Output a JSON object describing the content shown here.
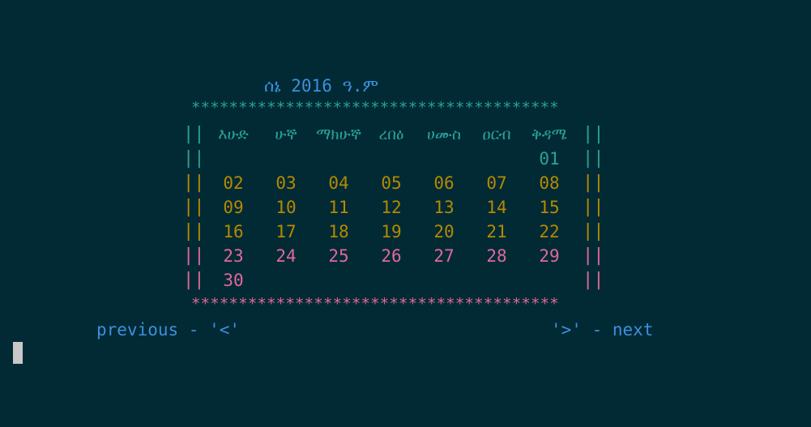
{
  "calendar": {
    "title": "ሰኔ 2016 ዓ.ም",
    "border_stars": "***************************************",
    "side_bar": "||",
    "weekdays": [
      "እሁድ",
      "ሁኞ",
      "ማክሁኞ",
      "ረበዕ",
      "ሀሙስ",
      "ዐርብ",
      "ቅዳሜ"
    ],
    "weeks": [
      [
        "",
        "",
        "",
        "",
        "",
        "",
        "01"
      ],
      [
        "02",
        "03",
        "04",
        "05",
        "06",
        "07",
        "08"
      ],
      [
        "09",
        "10",
        "11",
        "12",
        "13",
        "14",
        "15"
      ],
      [
        "16",
        "17",
        "18",
        "19",
        "20",
        "21",
        "22"
      ],
      [
        "23",
        "24",
        "25",
        "26",
        "27",
        "28",
        "29"
      ],
      [
        "30",
        "",
        "",
        "",
        "",
        "",
        ""
      ]
    ]
  },
  "navigation": {
    "previous_label": "previous - '<'",
    "next_label": "'>' - next"
  },
  "colors": {
    "background": "#012a35",
    "title": "#3d8fdc",
    "teal": "#2aa198",
    "gold": "#b58900",
    "pink": "#e0689a",
    "cursor": "#c8c8c8"
  }
}
